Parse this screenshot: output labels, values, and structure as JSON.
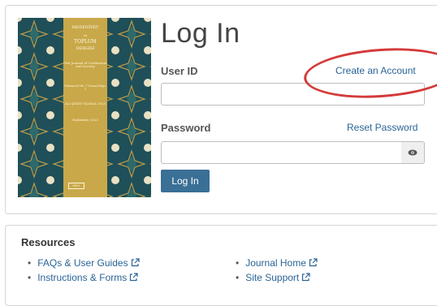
{
  "login": {
    "title": "Log In",
    "user_id_label": "User ID",
    "create_account_link": "Create an Account",
    "password_label": "Password",
    "reset_password_link": "Reset Password",
    "login_button": "Log In"
  },
  "cover": {
    "line1": "MEDENİYET",
    "line2": "ve",
    "line3": "TOPLUM",
    "line4": "DERGİSİ",
    "subtitle": "The Journal of Civilization and Society",
    "volume": "Volume/Cilt: 7 Issue/Sayı: 1",
    "extra1": "ALI ŞİRİN YILMAZ 2023",
    "extra2": "Hadımköy 2023",
    "publisher": "MDY"
  },
  "resources": {
    "heading": "Resources",
    "items": [
      {
        "label": "FAQs & User Guides"
      },
      {
        "label": "Instructions & Forms"
      },
      {
        "label": "Journal Home"
      },
      {
        "label": "Site Support"
      }
    ]
  },
  "colors": {
    "link": "#2a6496",
    "button": "#3a6f96",
    "annotation_circle": "#d43a3a",
    "cover_bg": "#1f4f58",
    "cover_panel": "#c9a84a"
  },
  "icons": {
    "external": "external-link-icon",
    "eye": "eye-icon"
  }
}
